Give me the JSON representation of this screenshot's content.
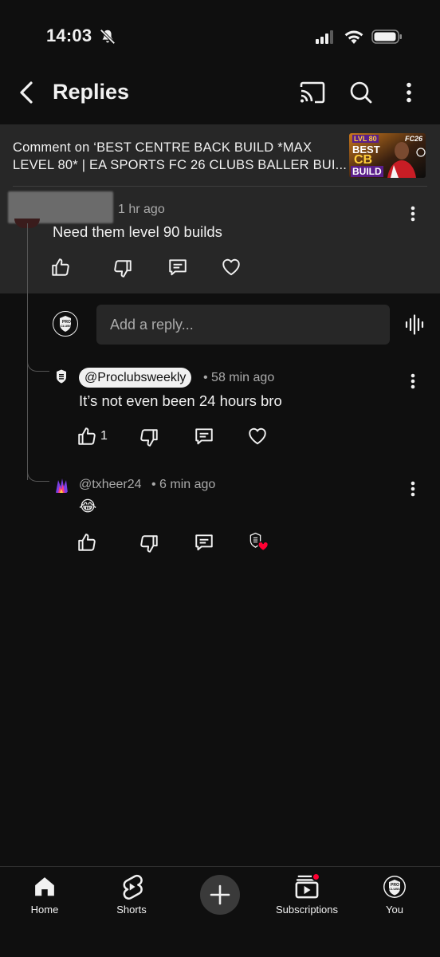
{
  "status_bar": {
    "time": "14:03"
  },
  "header": {
    "title": "Replies"
  },
  "video_context": {
    "text": "Comment on ‘BEST CENTRE BACK BUILD *MAX LEVEL 80* | EA SPORTS FC 26 CLUBS BALLER BUI...",
    "thumb": {
      "line1": "LVL 80",
      "line2": "BEST",
      "line3": "CB",
      "line4": "BUILD",
      "badge": "FC26"
    }
  },
  "parent_comment": {
    "time": "1 hr ago",
    "text": "Need them level 90 builds"
  },
  "composer": {
    "placeholder": "Add a reply..."
  },
  "replies": [
    {
      "author": "@Proclubsweekly",
      "meta": "• 58 min ago",
      "text": "It’s not even been 24 hours bro",
      "like_count": "1"
    },
    {
      "author": "@txheer24",
      "meta": "• 6 min ago",
      "text": "😂"
    }
  ],
  "channel_logo_text": {
    "line1": "PRO",
    "line2": "CLUBS",
    "line3": "WEEKLY"
  },
  "bottom_nav": {
    "home": "Home",
    "shorts": "Shorts",
    "subscriptions": "Subscriptions",
    "you": "You"
  },
  "colors": {
    "background": "#0f0f0f",
    "surface": "#272727",
    "text": "#f1f1f1",
    "muted": "#aaaaaa",
    "heart_red": "#ff0033"
  }
}
